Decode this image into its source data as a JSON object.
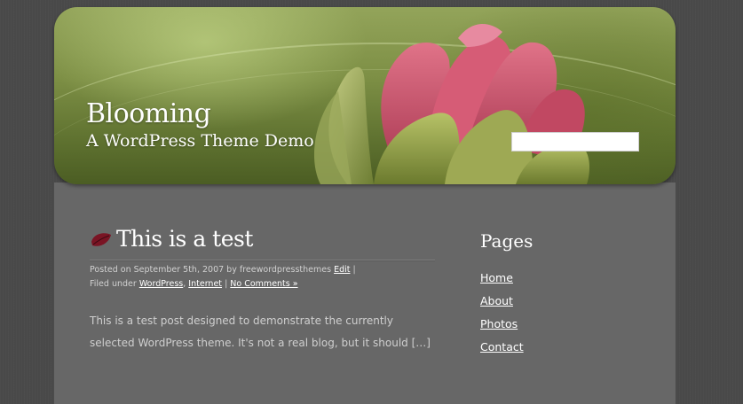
{
  "header": {
    "site_title": "Blooming",
    "site_description": "A WordPress Theme Demo",
    "search_value": ""
  },
  "post": {
    "title": "This is a test",
    "meta": {
      "posted_on": "Posted on September 5th, 2007 by freewordpressthemes",
      "edit_label": "Edit",
      "filed_under": "Filed under",
      "categories": [
        "WordPress",
        "Internet"
      ],
      "comments_label": "No Comments »"
    },
    "excerpt": "This is a test post designed to demonstrate the currently selected WordPress theme. It's not a real blog, but it should […]"
  },
  "sidebar": {
    "heading": "Pages",
    "items": [
      {
        "label": "Home"
      },
      {
        "label": "About"
      },
      {
        "label": "Photos"
      },
      {
        "label": "Contact"
      }
    ]
  },
  "colors": {
    "page_background": "#494949",
    "content_background": "#676767",
    "link": "#ffffff",
    "header_green": "#7d8f45",
    "flower_pink": "#c9526a"
  },
  "icons": {
    "post_icon": "leaf-icon"
  }
}
